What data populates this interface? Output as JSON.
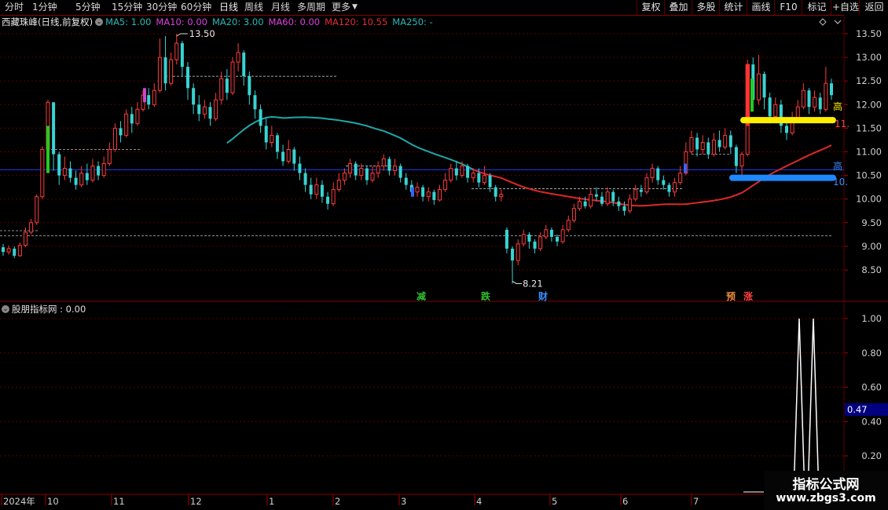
{
  "toolbar": {
    "periods": [
      "分时",
      "1分钟",
      "5分钟",
      "15分钟",
      "30分钟",
      "60分钟",
      "日线",
      "周线",
      "月线",
      "多周期",
      "更多"
    ],
    "active_period": "日线",
    "right_buttons": [
      "复权",
      "叠加",
      "多股",
      "统计",
      "画线",
      "F10",
      "标记",
      "+自选",
      "返回"
    ]
  },
  "main_legend": {
    "title": "西藏珠峰(日线,前复权)",
    "ma": [
      {
        "label": "MA5: 1.00",
        "color": "#2cb7b7"
      },
      {
        "label": "MA10: 0.00",
        "color": "#e040e0"
      },
      {
        "label": "MA20: 3.00",
        "color": "#2cb7b7"
      },
      {
        "label": "MA60: 0.00",
        "color": "#e040e0"
      },
      {
        "label": "MA120: 10.55",
        "color": "#e23030"
      },
      {
        "label": "MA250: -",
        "color": "#2cb7b7"
      }
    ]
  },
  "sub_legend": {
    "title": "股朋指标网 : 0.00"
  },
  "price_axis": [
    "13.50",
    "13.00",
    "12.50",
    "12.00",
    "11.50",
    "11.00",
    "10.50",
    "10.00",
    "9.50",
    "9.00",
    "8.50"
  ],
  "indicator_axis": [
    "1.00",
    "0.80",
    "0.60",
    "0.40",
    "0.20"
  ],
  "indicator_current": "0.47",
  "time_axis": [
    "2024年",
    "10",
    "11",
    "12",
    "1",
    "2",
    "3",
    "4",
    "5",
    "6",
    "7"
  ],
  "price_labels": {
    "high": "13.50",
    "low": "8.21"
  },
  "signals": [
    {
      "text": "减",
      "color": "#2fbf2f"
    },
    {
      "text": "跌",
      "color": "#2fbf2f"
    },
    {
      "text": "财",
      "color": "#3a8cff"
    },
    {
      "text": "预",
      "color": "#e88a3a"
    },
    {
      "text": "涨",
      "color": "#ff4040"
    }
  ],
  "right_marks": {
    "high1": "高",
    "high2": "高",
    "val1": "11.",
    "val2": "10."
  },
  "watermark": {
    "title": "指标公式网",
    "url": "www.zbgs3.com"
  },
  "colors": {
    "up": "#ff3b3b",
    "down": "#39d3d3",
    "grid": "#5a0000",
    "axis_text": "#d0d0d0"
  },
  "chart_data": {
    "type": "candlestick",
    "ylim": [
      8.0,
      13.8
    ],
    "indicator_ylim": [
      0,
      1.1
    ],
    "candles": [
      {
        "o": 8.98,
        "c": 8.88,
        "h": 9.05,
        "l": 8.8
      },
      {
        "o": 8.88,
        "c": 8.95,
        "h": 9.02,
        "l": 8.82
      },
      {
        "o": 8.95,
        "c": 8.8,
        "h": 9.0,
        "l": 8.75
      },
      {
        "o": 8.8,
        "c": 9.02,
        "h": 9.08,
        "l": 8.78
      },
      {
        "o": 9.02,
        "c": 9.3,
        "h": 9.4,
        "l": 8.98
      },
      {
        "o": 9.3,
        "c": 9.5,
        "h": 9.58,
        "l": 9.25
      },
      {
        "o": 9.5,
        "c": 10.05,
        "h": 10.1,
        "l": 9.45
      },
      {
        "o": 10.05,
        "c": 11.05,
        "h": 11.12,
        "l": 10.0
      },
      {
        "o": 11.05,
        "c": 12.05,
        "h": 12.1,
        "l": 10.8
      },
      {
        "o": 12.05,
        "c": 10.95,
        "h": 12.0,
        "l": 10.6
      },
      {
        "o": 10.95,
        "c": 10.5,
        "h": 11.0,
        "l": 10.3
      },
      {
        "o": 10.5,
        "c": 10.65,
        "h": 10.9,
        "l": 10.4
      },
      {
        "o": 10.65,
        "c": 10.45,
        "h": 10.8,
        "l": 10.35
      },
      {
        "o": 10.45,
        "c": 10.3,
        "h": 10.6,
        "l": 10.2
      },
      {
        "o": 10.3,
        "c": 10.55,
        "h": 10.7,
        "l": 10.25
      },
      {
        "o": 10.55,
        "c": 10.4,
        "h": 10.75,
        "l": 10.3
      },
      {
        "o": 10.4,
        "c": 10.7,
        "h": 10.85,
        "l": 10.35
      },
      {
        "o": 10.7,
        "c": 10.5,
        "h": 10.8,
        "l": 10.4
      },
      {
        "o": 10.5,
        "c": 10.75,
        "h": 10.9,
        "l": 10.45
      },
      {
        "o": 10.75,
        "c": 11.05,
        "h": 11.2,
        "l": 10.7
      },
      {
        "o": 11.05,
        "c": 11.5,
        "h": 11.6,
        "l": 11.0
      },
      {
        "o": 11.5,
        "c": 11.35,
        "h": 11.65,
        "l": 11.2
      },
      {
        "o": 11.35,
        "c": 11.8,
        "h": 11.9,
        "l": 11.3
      },
      {
        "o": 11.8,
        "c": 11.6,
        "h": 11.95,
        "l": 11.4
      },
      {
        "o": 11.6,
        "c": 11.9,
        "h": 12.05,
        "l": 11.55
      },
      {
        "o": 11.9,
        "c": 12.2,
        "h": 12.3,
        "l": 11.85
      },
      {
        "o": 12.2,
        "c": 12.0,
        "h": 12.35,
        "l": 11.9
      },
      {
        "o": 12.0,
        "c": 12.3,
        "h": 12.45,
        "l": 11.95
      },
      {
        "o": 12.3,
        "c": 13.0,
        "h": 13.4,
        "l": 12.25
      },
      {
        "o": 13.0,
        "c": 12.45,
        "h": 13.45,
        "l": 12.3
      },
      {
        "o": 12.45,
        "c": 12.95,
        "h": 13.1,
        "l": 12.4
      },
      {
        "o": 12.95,
        "c": 13.3,
        "h": 13.5,
        "l": 12.85
      },
      {
        "o": 13.3,
        "c": 12.8,
        "h": 13.35,
        "l": 12.6
      },
      {
        "o": 12.8,
        "c": 12.35,
        "h": 12.9,
        "l": 12.1
      },
      {
        "o": 12.35,
        "c": 12.0,
        "h": 12.45,
        "l": 11.8
      },
      {
        "o": 12.0,
        "c": 11.8,
        "h": 12.2,
        "l": 11.65
      },
      {
        "o": 11.8,
        "c": 11.95,
        "h": 12.1,
        "l": 11.7
      },
      {
        "o": 11.95,
        "c": 11.7,
        "h": 12.05,
        "l": 11.55
      },
      {
        "o": 11.7,
        "c": 12.1,
        "h": 12.25,
        "l": 11.65
      },
      {
        "o": 12.1,
        "c": 12.55,
        "h": 12.7,
        "l": 12.0
      },
      {
        "o": 12.55,
        "c": 12.25,
        "h": 12.75,
        "l": 12.1
      },
      {
        "o": 12.25,
        "c": 12.9,
        "h": 13.0,
        "l": 12.2
      },
      {
        "o": 12.9,
        "c": 13.1,
        "h": 13.3,
        "l": 12.7
      },
      {
        "o": 13.1,
        "c": 12.6,
        "h": 13.15,
        "l": 12.4
      },
      {
        "o": 12.6,
        "c": 12.2,
        "h": 12.7,
        "l": 12.0
      },
      {
        "o": 12.2,
        "c": 11.9,
        "h": 12.3,
        "l": 11.7
      },
      {
        "o": 11.9,
        "c": 11.55,
        "h": 12.0,
        "l": 11.4
      },
      {
        "o": 11.55,
        "c": 11.2,
        "h": 11.7,
        "l": 11.05
      },
      {
        "o": 11.2,
        "c": 11.35,
        "h": 11.55,
        "l": 11.1
      },
      {
        "o": 11.35,
        "c": 11.0,
        "h": 11.4,
        "l": 10.85
      },
      {
        "o": 11.0,
        "c": 10.8,
        "h": 11.15,
        "l": 10.7
      },
      {
        "o": 10.8,
        "c": 11.05,
        "h": 11.25,
        "l": 10.75
      },
      {
        "o": 11.05,
        "c": 10.75,
        "h": 11.1,
        "l": 10.6
      },
      {
        "o": 10.75,
        "c": 10.55,
        "h": 10.9,
        "l": 10.4
      },
      {
        "o": 10.55,
        "c": 10.3,
        "h": 10.65,
        "l": 10.15
      },
      {
        "o": 10.3,
        "c": 10.1,
        "h": 10.45,
        "l": 10.0
      },
      {
        "o": 10.1,
        "c": 10.3,
        "h": 10.45,
        "l": 10.0
      },
      {
        "o": 10.3,
        "c": 10.05,
        "h": 10.4,
        "l": 9.92
      },
      {
        "o": 10.05,
        "c": 9.9,
        "h": 10.15,
        "l": 9.78
      },
      {
        "o": 9.9,
        "c": 10.2,
        "h": 10.35,
        "l": 9.85
      },
      {
        "o": 10.2,
        "c": 10.4,
        "h": 10.55,
        "l": 10.15
      },
      {
        "o": 10.4,
        "c": 10.55,
        "h": 10.65,
        "l": 10.3
      },
      {
        "o": 10.55,
        "c": 10.75,
        "h": 10.85,
        "l": 10.45
      },
      {
        "o": 10.75,
        "c": 10.5,
        "h": 10.8,
        "l": 10.4
      },
      {
        "o": 10.5,
        "c": 10.65,
        "h": 10.75,
        "l": 10.4
      },
      {
        "o": 10.65,
        "c": 10.4,
        "h": 10.7,
        "l": 10.3
      },
      {
        "o": 10.4,
        "c": 10.55,
        "h": 10.7,
        "l": 10.35
      },
      {
        "o": 10.55,
        "c": 10.7,
        "h": 10.8,
        "l": 10.45
      },
      {
        "o": 10.7,
        "c": 10.85,
        "h": 10.95,
        "l": 10.6
      },
      {
        "o": 10.85,
        "c": 10.6,
        "h": 10.9,
        "l": 10.5
      },
      {
        "o": 10.6,
        "c": 10.7,
        "h": 10.85,
        "l": 10.5
      },
      {
        "o": 10.7,
        "c": 10.45,
        "h": 10.75,
        "l": 10.35
      },
      {
        "o": 10.45,
        "c": 10.3,
        "h": 10.55,
        "l": 10.2
      },
      {
        "o": 10.3,
        "c": 10.15,
        "h": 10.4,
        "l": 10.05
      },
      {
        "o": 10.15,
        "c": 10.25,
        "h": 10.35,
        "l": 10.05
      },
      {
        "o": 10.25,
        "c": 10.05,
        "h": 10.3,
        "l": 9.95
      },
      {
        "o": 10.05,
        "c": 10.15,
        "h": 10.25,
        "l": 9.95
      },
      {
        "o": 10.15,
        "c": 9.98,
        "h": 10.2,
        "l": 9.88
      },
      {
        "o": 9.98,
        "c": 10.2,
        "h": 10.3,
        "l": 9.95
      },
      {
        "o": 10.2,
        "c": 10.4,
        "h": 10.55,
        "l": 10.15
      },
      {
        "o": 10.4,
        "c": 10.65,
        "h": 10.75,
        "l": 10.35
      },
      {
        "o": 10.65,
        "c": 10.5,
        "h": 10.8,
        "l": 10.4
      },
      {
        "o": 10.5,
        "c": 10.7,
        "h": 10.8,
        "l": 10.45
      },
      {
        "o": 10.7,
        "c": 10.45,
        "h": 10.75,
        "l": 10.35
      },
      {
        "o": 10.45,
        "c": 10.55,
        "h": 10.65,
        "l": 10.35
      },
      {
        "o": 10.55,
        "c": 10.35,
        "h": 10.65,
        "l": 10.25
      },
      {
        "o": 10.35,
        "c": 10.5,
        "h": 10.7,
        "l": 10.3
      },
      {
        "o": 10.5,
        "c": 10.25,
        "h": 10.55,
        "l": 10.15
      },
      {
        "o": 10.25,
        "c": 10.05,
        "h": 10.3,
        "l": 9.95
      },
      {
        "o": 10.05,
        "c": 10.1,
        "h": 10.2,
        "l": 9.95
      },
      {
        "o": 9.35,
        "c": 8.95,
        "h": 9.4,
        "l": 8.85
      },
      {
        "o": 8.95,
        "c": 8.7,
        "h": 9.0,
        "l": 8.21
      },
      {
        "o": 8.7,
        "c": 9.05,
        "h": 9.15,
        "l": 8.6
      },
      {
        "o": 9.05,
        "c": 9.25,
        "h": 9.35,
        "l": 9.0
      },
      {
        "o": 9.25,
        "c": 9.1,
        "h": 9.3,
        "l": 8.95
      },
      {
        "o": 9.1,
        "c": 8.95,
        "h": 9.15,
        "l": 8.85
      },
      {
        "o": 8.95,
        "c": 9.2,
        "h": 9.3,
        "l": 8.9
      },
      {
        "o": 9.2,
        "c": 9.35,
        "h": 9.45,
        "l": 9.15
      },
      {
        "o": 9.35,
        "c": 9.2,
        "h": 9.4,
        "l": 9.1
      },
      {
        "o": 9.2,
        "c": 9.1,
        "h": 9.25,
        "l": 9.0
      },
      {
        "o": 9.1,
        "c": 9.35,
        "h": 9.45,
        "l": 9.05
      },
      {
        "o": 9.35,
        "c": 9.55,
        "h": 9.65,
        "l": 9.3
      },
      {
        "o": 9.55,
        "c": 9.8,
        "h": 9.9,
        "l": 9.5
      },
      {
        "o": 9.8,
        "c": 9.95,
        "h": 10.05,
        "l": 9.75
      },
      {
        "o": 9.95,
        "c": 9.85,
        "h": 10.05,
        "l": 9.8
      },
      {
        "o": 9.85,
        "c": 10.1,
        "h": 10.2,
        "l": 9.8
      },
      {
        "o": 10.1,
        "c": 10.05,
        "h": 10.25,
        "l": 9.95
      },
      {
        "o": 10.05,
        "c": 9.9,
        "h": 10.15,
        "l": 9.85
      },
      {
        "o": 9.9,
        "c": 10.15,
        "h": 10.25,
        "l": 9.85
      },
      {
        "o": 10.15,
        "c": 9.95,
        "h": 10.2,
        "l": 9.85
      },
      {
        "o": 9.95,
        "c": 9.85,
        "h": 10.05,
        "l": 9.75
      },
      {
        "o": 9.85,
        "c": 9.75,
        "h": 9.95,
        "l": 9.65
      },
      {
        "o": 9.75,
        "c": 10.0,
        "h": 10.1,
        "l": 9.7
      },
      {
        "o": 10.0,
        "c": 10.2,
        "h": 10.3,
        "l": 9.95
      },
      {
        "o": 10.2,
        "c": 10.15,
        "h": 10.3,
        "l": 10.05
      },
      {
        "o": 10.15,
        "c": 10.45,
        "h": 10.55,
        "l": 10.1
      },
      {
        "o": 10.45,
        "c": 10.65,
        "h": 10.75,
        "l": 10.35
      },
      {
        "o": 10.65,
        "c": 10.4,
        "h": 10.7,
        "l": 10.3
      },
      {
        "o": 10.4,
        "c": 10.3,
        "h": 10.5,
        "l": 10.2
      },
      {
        "o": 10.3,
        "c": 10.15,
        "h": 10.35,
        "l": 10.05
      },
      {
        "o": 10.15,
        "c": 10.35,
        "h": 10.45,
        "l": 10.05
      },
      {
        "o": 10.35,
        "c": 10.55,
        "h": 10.7,
        "l": 10.3
      },
      {
        "o": 10.55,
        "c": 11.0,
        "h": 11.2,
        "l": 10.5
      },
      {
        "o": 11.0,
        "c": 11.3,
        "h": 11.45,
        "l": 10.95
      },
      {
        "o": 11.3,
        "c": 11.05,
        "h": 11.4,
        "l": 10.9
      },
      {
        "o": 11.05,
        "c": 11.2,
        "h": 11.35,
        "l": 10.95
      },
      {
        "o": 11.2,
        "c": 10.95,
        "h": 11.3,
        "l": 10.85
      },
      {
        "o": 10.95,
        "c": 11.25,
        "h": 11.4,
        "l": 10.9
      },
      {
        "o": 11.25,
        "c": 11.1,
        "h": 11.45,
        "l": 11.0
      },
      {
        "o": 11.1,
        "c": 11.35,
        "h": 11.5,
        "l": 11.05
      },
      {
        "o": 11.35,
        "c": 11.1,
        "h": 11.45,
        "l": 10.95
      },
      {
        "o": 11.1,
        "c": 10.7,
        "h": 11.15,
        "l": 10.55
      },
      {
        "o": 10.7,
        "c": 10.95,
        "h": 11.0,
        "l": 10.5
      },
      {
        "o": 10.95,
        "c": 12.85,
        "h": 12.95,
        "l": 10.9
      },
      {
        "o": 12.85,
        "c": 12.1,
        "h": 13.0,
        "l": 11.95
      },
      {
        "o": 12.1,
        "c": 12.65,
        "h": 13.05,
        "l": 12.0
      },
      {
        "o": 12.65,
        "c": 12.15,
        "h": 12.7,
        "l": 11.9
      },
      {
        "o": 12.15,
        "c": 11.75,
        "h": 12.25,
        "l": 11.6
      },
      {
        "o": 11.75,
        "c": 12.0,
        "h": 12.15,
        "l": 11.65
      },
      {
        "o": 12.0,
        "c": 11.55,
        "h": 12.1,
        "l": 11.4
      },
      {
        "o": 11.55,
        "c": 11.4,
        "h": 11.65,
        "l": 11.25
      },
      {
        "o": 11.4,
        "c": 11.7,
        "h": 11.85,
        "l": 11.35
      },
      {
        "o": 11.7,
        "c": 11.95,
        "h": 12.1,
        "l": 11.65
      },
      {
        "o": 11.95,
        "c": 12.3,
        "h": 12.45,
        "l": 11.9
      },
      {
        "o": 12.3,
        "c": 11.95,
        "h": 12.35,
        "l": 11.8
      },
      {
        "o": 11.95,
        "c": 12.15,
        "h": 12.3,
        "l": 11.85
      },
      {
        "o": 12.15,
        "c": 11.9,
        "h": 12.25,
        "l": 11.8
      },
      {
        "o": 11.9,
        "c": 12.45,
        "h": 12.8,
        "l": 11.85
      },
      {
        "o": 12.45,
        "c": 12.2,
        "h": 12.55,
        "l": 12.1
      }
    ]
  }
}
